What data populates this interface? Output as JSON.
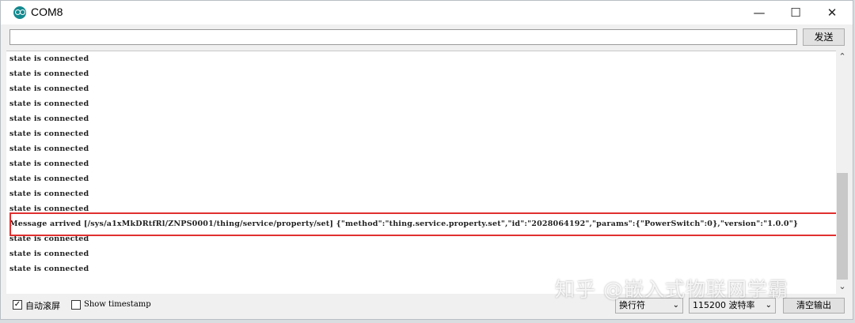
{
  "window": {
    "title": "COM8",
    "minimize_glyph": "—",
    "maximize_glyph": "☐",
    "close_glyph": "✕"
  },
  "send": {
    "input_value": "",
    "button_label": "发送"
  },
  "console_lines": [
    "state is connected",
    "state is connected",
    "state is connected",
    "state is connected",
    "state is connected",
    "state is connected",
    "state is connected",
    "state is connected",
    "state is connected",
    "state is connected",
    "state is connected",
    "Message arrived [/sys/a1xMkDRtfRl/ZNPS0001/thing/service/property/set] {\"method\":\"thing.service.property.set\",\"id\":\"2028064192\",\"params\":{\"PowerSwitch\":0},\"version\":\"1.0.0\"}",
    "state is connected",
    "state is connected",
    "state is connected"
  ],
  "footer": {
    "autoscroll_label": "自动滚屏",
    "autoscroll_checked": true,
    "timestamp_label": "Show timestamp",
    "timestamp_checked": false,
    "line_ending": "换行符",
    "baud_value": "115200",
    "baud_unit": "波特率",
    "clear_label": "清空输出"
  },
  "watermark": "知乎 @嵌入式物联网学霸",
  "icons": {
    "app": "arduino-icon",
    "scroll_up": "chevron-up-icon",
    "scroll_down": "chevron-down-icon"
  },
  "colors": {
    "highlight": "#e03030",
    "app_icon": "#13898f"
  }
}
